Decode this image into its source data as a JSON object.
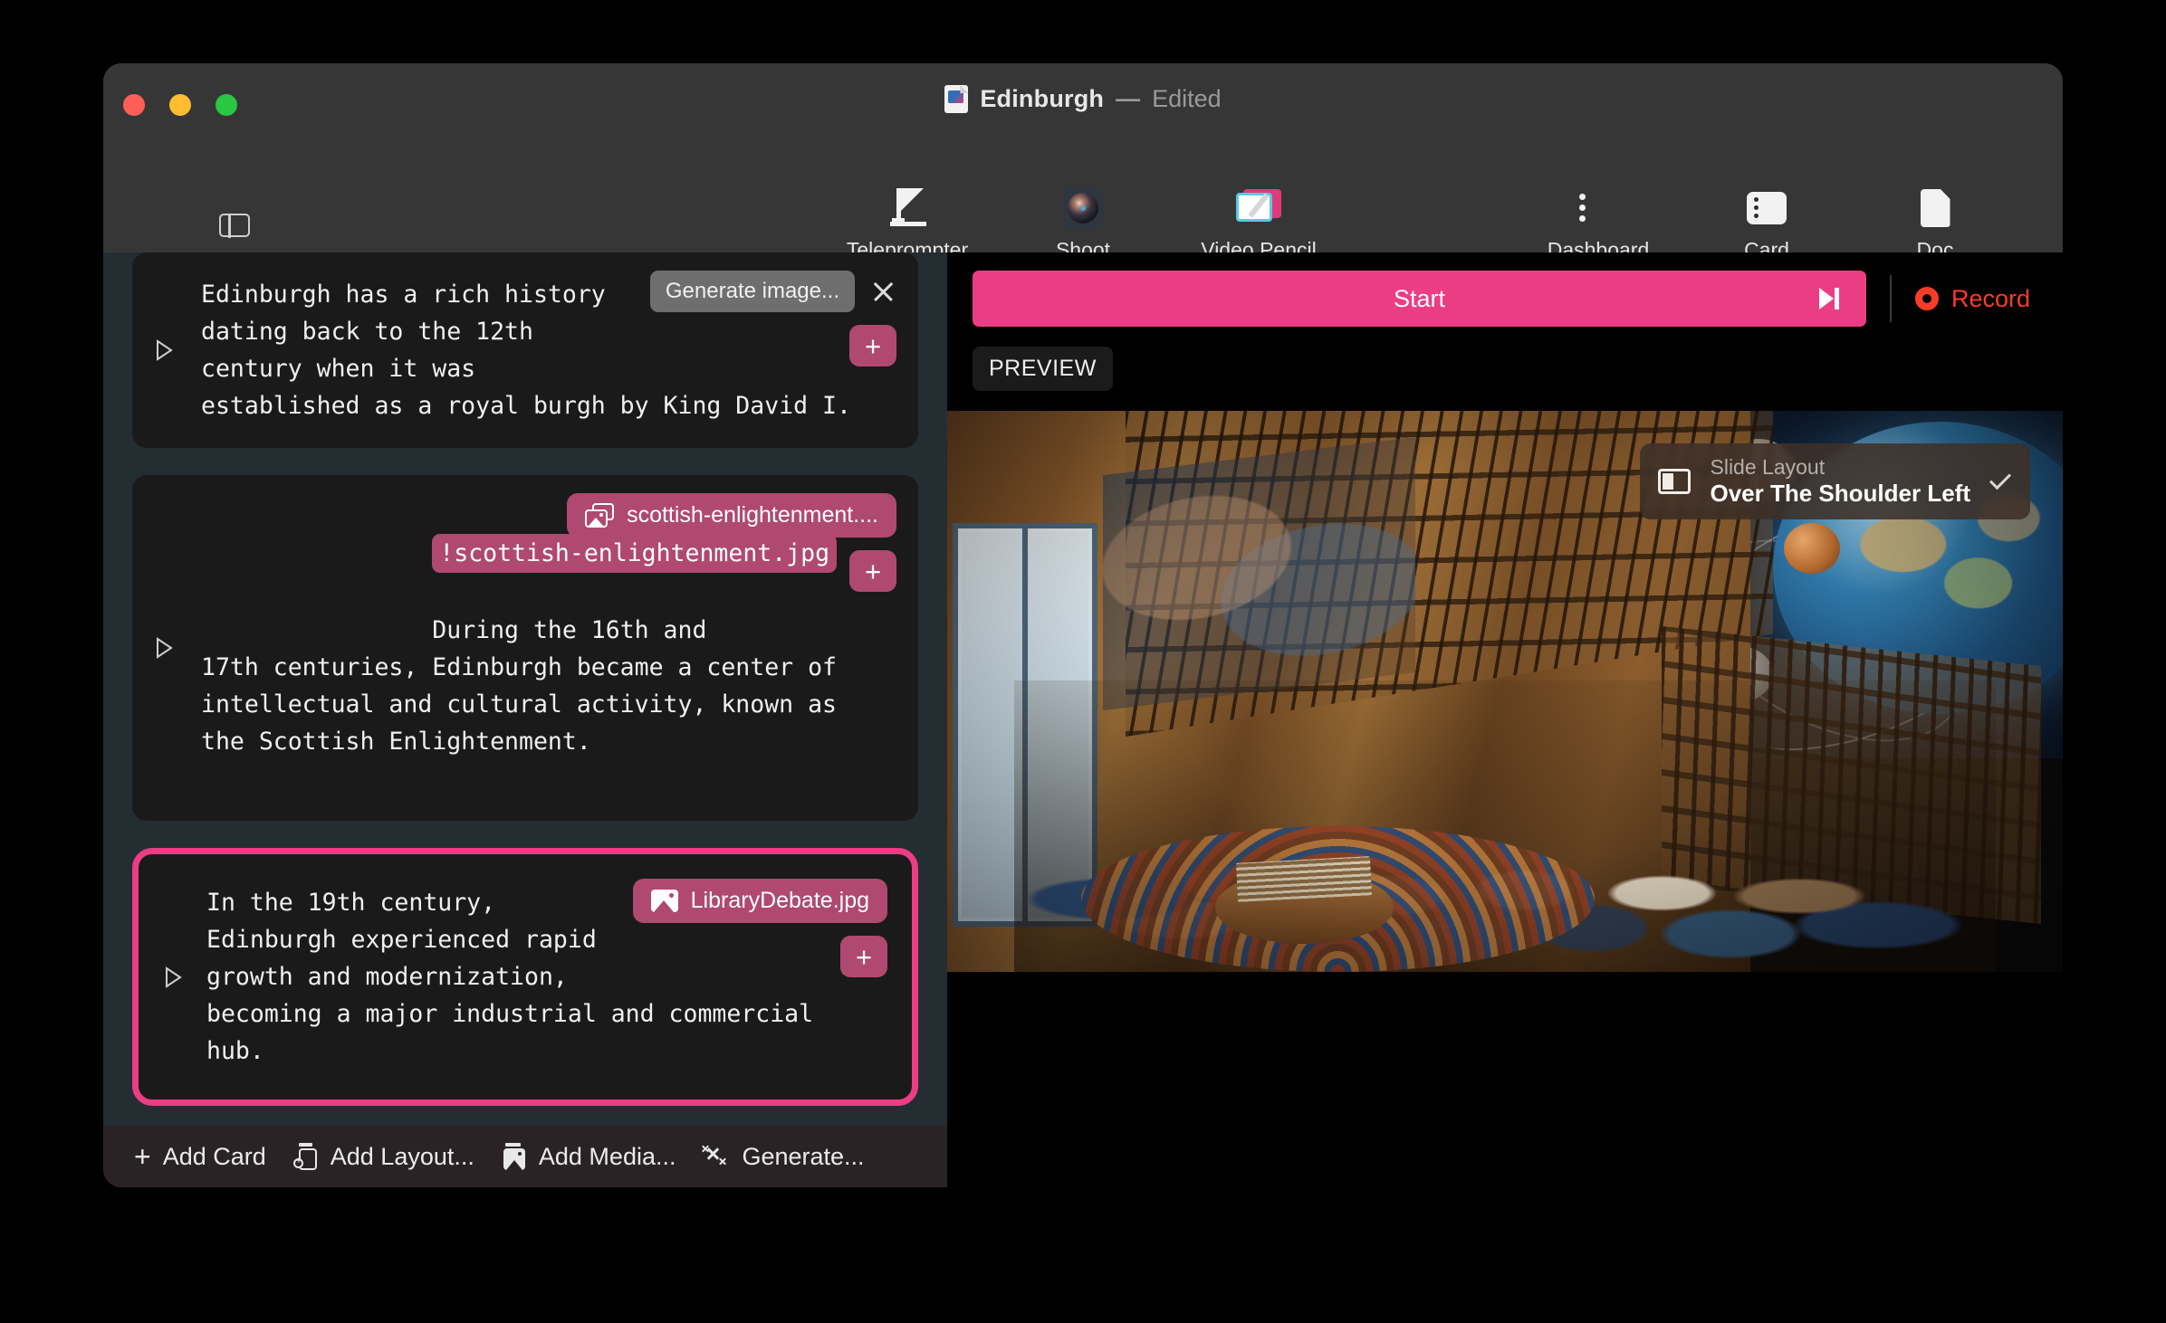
{
  "window": {
    "title": "Edinburgh",
    "separator": "—",
    "state": "Edited"
  },
  "toolbar": {
    "sidebar_toggle_icon": "sidebar-toggle-icon",
    "center_items": [
      {
        "label": "Teleprompter",
        "icon": "teleprompter-icon"
      },
      {
        "label": "Shoot",
        "icon": "camera-lens-icon"
      },
      {
        "label": "Video Pencil",
        "icon": "video-pencil-icon"
      }
    ],
    "right_items": [
      {
        "label": "Dashboard",
        "icon": "list-icon"
      },
      {
        "label": "Card",
        "icon": "card-list-icon"
      },
      {
        "label": "Doc",
        "icon": "document-icon"
      }
    ]
  },
  "cards": [
    {
      "selected": false,
      "text": "Edinburgh has a rich history\ndating back to the 12th\ncentury when it was\nestablished as a royal burgh by King David I.",
      "generate_label": "Generate image...",
      "has_close": true,
      "plus_label": "+"
    },
    {
      "selected": false,
      "token": "!scottish-enlightenment.jpg",
      "text": "During the 16th and\n17th centuries, Edinburgh became a center of\nintellectual and cultural activity, known as\nthe Scottish Enlightenment.",
      "media_label": "scottish-enlightenment....",
      "media_icon": "photo-stack-icon",
      "plus_label": "+"
    },
    {
      "selected": true,
      "text": "In the 19th century,\nEdinburgh experienced rapid\ngrowth and modernization, \nbecoming a major industrial and commercial hub.",
      "media_label": "LibraryDebate.jpg",
      "media_icon": "photo-icon",
      "plus_label": "+"
    }
  ],
  "bottom_bar": {
    "items": [
      {
        "label": "Add Card",
        "icon": "plus-icon"
      },
      {
        "label": "Add Layout...",
        "icon": "add-layout-icon"
      },
      {
        "label": "Add Media...",
        "icon": "add-media-icon"
      },
      {
        "label": "Generate...",
        "icon": "sparkle-icon"
      }
    ]
  },
  "preview": {
    "start_label": "Start",
    "skip_icon": "skip-forward-icon",
    "record_label": "Record",
    "record_icon": "record-dot-icon",
    "preview_badge": "PREVIEW",
    "slide_layout": {
      "title": "Slide Layout",
      "value": "Over The Shoulder Left",
      "icon": "slide-layout-icon",
      "chevron": "chevron-down-icon"
    }
  },
  "colors": {
    "accent_pink": "#ec3d84",
    "chip_pink": "#b0496f",
    "record_red": "#fa3c28",
    "panel_bg": "#242d31",
    "card_bg": "#1a1a1a"
  }
}
